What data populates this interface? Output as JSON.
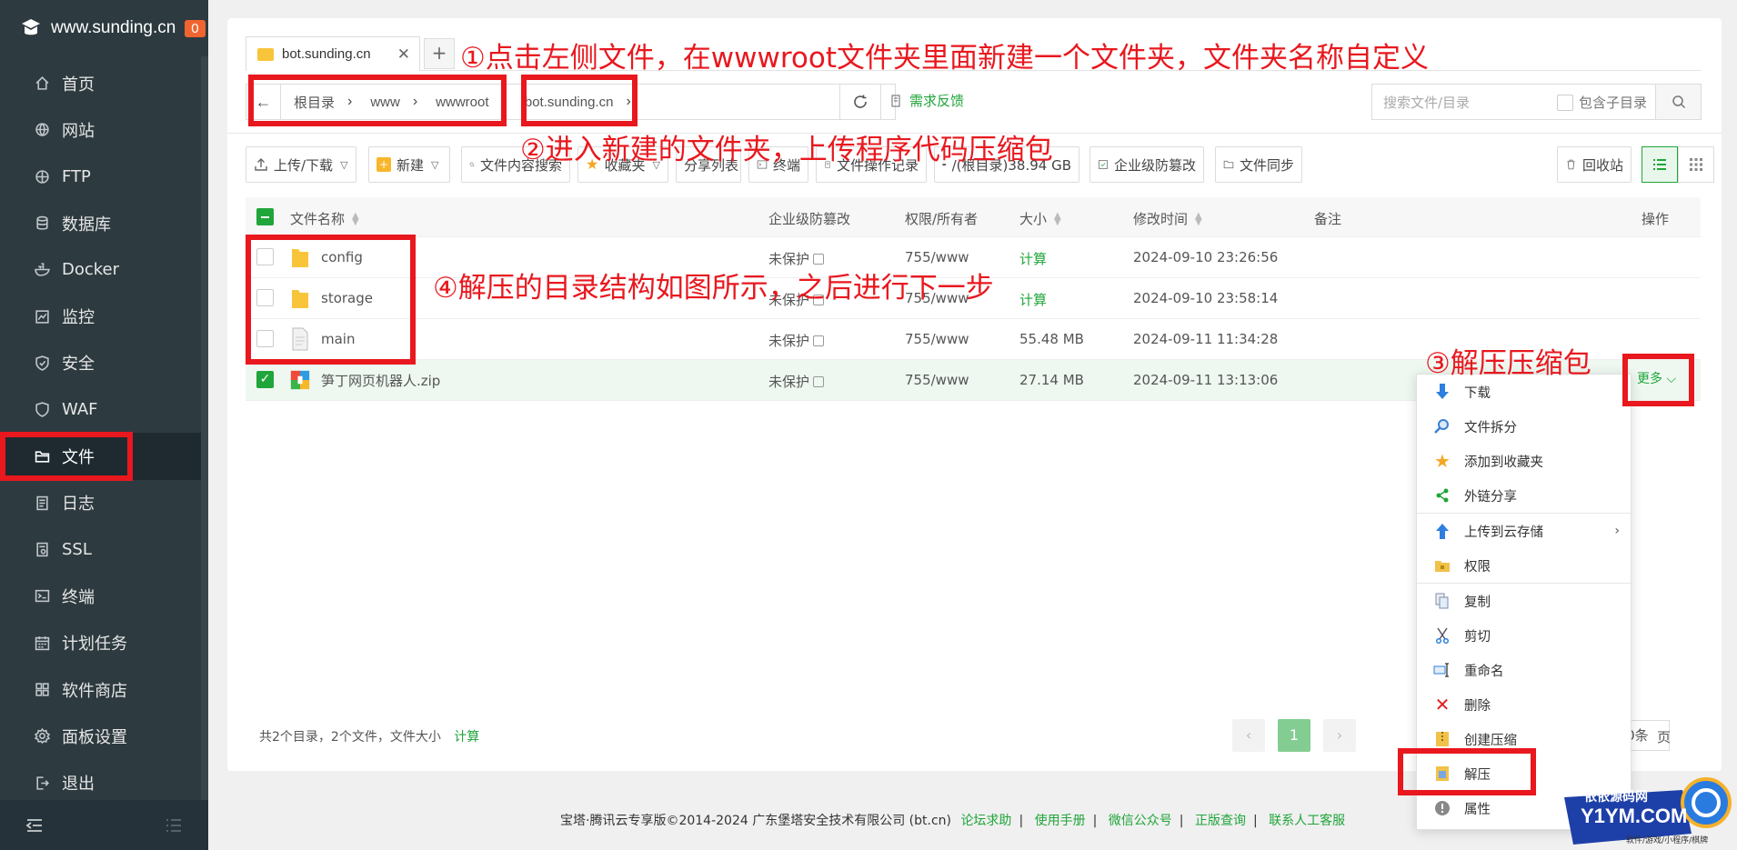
{
  "sidebar": {
    "site": "www.sunding.cn",
    "badge": "0",
    "items": [
      {
        "label": "首页",
        "icon": "home-icon"
      },
      {
        "label": "网站",
        "icon": "globe-icon"
      },
      {
        "label": "FTP",
        "icon": "ftp-globe-icon"
      },
      {
        "label": "数据库",
        "icon": "database-icon"
      },
      {
        "label": "Docker",
        "icon": "docker-icon"
      },
      {
        "label": "监控",
        "icon": "monitor-icon"
      },
      {
        "label": "安全",
        "icon": "shield-icon"
      },
      {
        "label": "WAF",
        "icon": "waf-shield-icon"
      },
      {
        "label": "文件",
        "icon": "folder-icon"
      },
      {
        "label": "日志",
        "icon": "log-icon"
      },
      {
        "label": "SSL",
        "icon": "ssl-icon"
      },
      {
        "label": "终端",
        "icon": "terminal-icon"
      },
      {
        "label": "计划任务",
        "icon": "calendar-icon"
      },
      {
        "label": "软件商店",
        "icon": "apps-icon"
      },
      {
        "label": "面板设置",
        "icon": "gear-icon"
      },
      {
        "label": "退出",
        "icon": "logout-icon"
      }
    ],
    "active": "文件"
  },
  "tabs": [
    {
      "label": "bot.sunding.cn"
    }
  ],
  "path": {
    "crumbs": [
      "根目录",
      "www",
      "wwwroot",
      "bot.sunding.cn"
    ],
    "feedback": "需求反馈"
  },
  "search": {
    "placeholder": "搜索文件/目录",
    "include_sub": "包含子目录"
  },
  "toolbar": {
    "upload": "上传/下载",
    "new": "新建",
    "content_search": "文件内容搜索",
    "favorites": "收藏夹",
    "share_list": "分享列表",
    "terminal": "终端",
    "op_log": "文件操作记录",
    "disk": "/(根目录)38.94 GB",
    "tamper": "企业级防篡改",
    "sync": "文件同步",
    "recycle": "回收站"
  },
  "table": {
    "headers": {
      "name": "文件名称",
      "tamper": "企业级防篡改",
      "perm": "权限/所有者",
      "size": "大小",
      "mtime": "修改时间",
      "note": "备注",
      "ops": "操作"
    },
    "rows": [
      {
        "name": "config",
        "type": "folder",
        "protect": "未保护",
        "perm": "755/www",
        "size": "计算",
        "mtime": "2024-09-10 23:26:56",
        "checked": false
      },
      {
        "name": "storage",
        "type": "folder",
        "protect": "未保护",
        "perm": "755/www",
        "size": "计算",
        "mtime": "2024-09-10 23:58:14",
        "checked": false
      },
      {
        "name": "main",
        "type": "file",
        "protect": "未保护",
        "perm": "755/www",
        "size": "55.48 MB",
        "mtime": "2024-09-11 11:34:28",
        "checked": false
      },
      {
        "name": "笋丁网页机器人.zip",
        "type": "zip",
        "protect": "未保护",
        "perm": "755/www",
        "size": "27.14 MB",
        "mtime": "2024-09-11 13:13:06",
        "checked": true
      }
    ],
    "more": "更多"
  },
  "summary": {
    "text": "共2个目录，2个文件，文件大小",
    "calc": "计算"
  },
  "pager": {
    "current": "1",
    "size": "500条",
    "page_label": "页"
  },
  "context_menu": [
    {
      "label": "下载",
      "icon": "download-icon"
    },
    {
      "label": "文件拆分",
      "icon": "split-icon"
    },
    {
      "label": "添加到收藏夹",
      "icon": "star-icon"
    },
    {
      "label": "外链分享",
      "icon": "share-icon"
    },
    {
      "label": "上传到云存储",
      "icon": "upload-cloud-icon",
      "submenu": true
    },
    {
      "label": "权限",
      "icon": "permission-icon"
    },
    {
      "label": "复制",
      "icon": "copy-icon"
    },
    {
      "label": "剪切",
      "icon": "cut-icon"
    },
    {
      "label": "重命名",
      "icon": "rename-icon"
    },
    {
      "label": "删除",
      "icon": "delete-icon"
    },
    {
      "label": "创建压缩",
      "icon": "compress-icon"
    },
    {
      "label": "解压",
      "icon": "extract-icon"
    },
    {
      "label": "属性",
      "icon": "info-icon"
    }
  ],
  "footer": {
    "copyright": "宝塔·腾讯云专享版©2014-2024 广东堡塔安全技术有限公司 (bt.cn)",
    "links": [
      "论坛求助",
      "使用手册",
      "微信公众号",
      "正版查询",
      "联系人工客服"
    ]
  },
  "annotations": {
    "step1": "①点击左侧文件，在wwwroot文件夹里面新建一个文件夹，文件夹名称自定义",
    "step2": "②进入新建的文件夹，上传程序代码压缩包",
    "step3": "③解压压缩包",
    "step4": "④解压的目录结构如图所示，之后进行下一步"
  },
  "watermark": {
    "line1": "依依源码网",
    "line2": "Y1YM.COM",
    "line3": "软件/游戏/小程序/棋牌"
  },
  "colors": {
    "accent": "#20a53a",
    "sidebar": "#2d3a40",
    "annotation": "#e8181e"
  }
}
